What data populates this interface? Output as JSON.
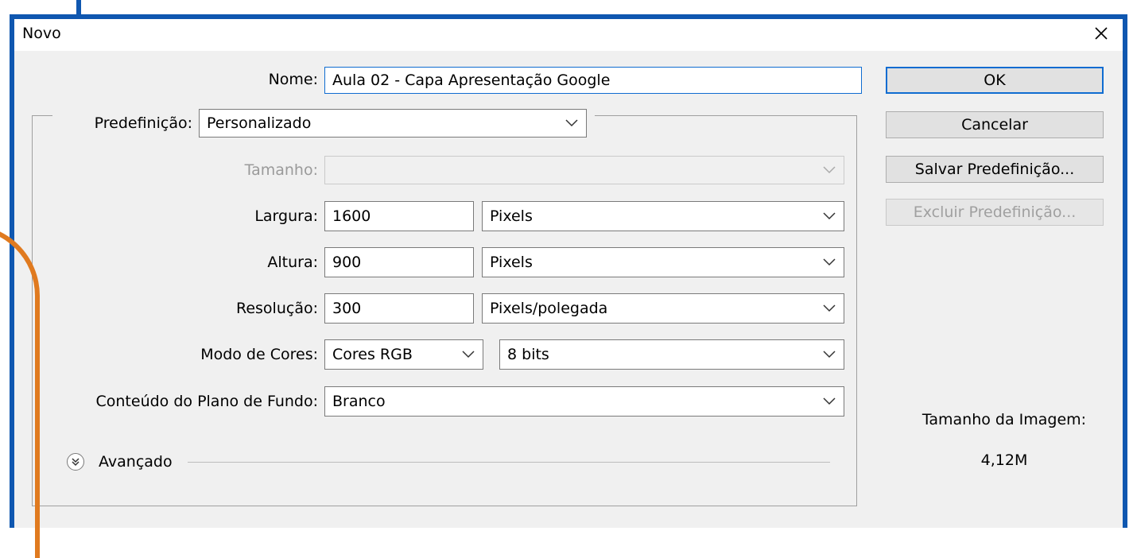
{
  "window": {
    "title": "Novo",
    "close_icon": "close-icon"
  },
  "form": {
    "nome_label": "Nome:",
    "nome_value": "Aula 02 - Capa Apresentação Google",
    "predefinicao_label": "Predefinição:",
    "predefinicao_value": "Personalizado",
    "tamanho_label": "Tamanho:",
    "tamanho_value": "",
    "largura_label": "Largura:",
    "largura_value": "1600",
    "largura_unit": "Pixels",
    "altura_label": "Altura:",
    "altura_value": "900",
    "altura_unit": "Pixels",
    "resolucao_label": "Resolução:",
    "resolucao_value": "300",
    "resolucao_unit": "Pixels/polegada",
    "modo_label": "Modo de Cores:",
    "modo_value": "Cores RGB",
    "modo_bits": "8 bits",
    "conteudo_label": "Conteúdo do Plano de Fundo:",
    "conteudo_value": "Branco",
    "avancado_label": "Avançado"
  },
  "buttons": {
    "ok": "OK",
    "cancel": "Cancelar",
    "save_preset": "Salvar Predefinição...",
    "delete_preset": "Excluir Predefinição..."
  },
  "info": {
    "image_size_label": "Tamanho da Imagem:",
    "image_size_value": "4,12M"
  },
  "colors": {
    "frame_blue": "#0f57b0",
    "annotation_orange": "#e07a1f",
    "focus_blue": "#0f6cd1"
  }
}
